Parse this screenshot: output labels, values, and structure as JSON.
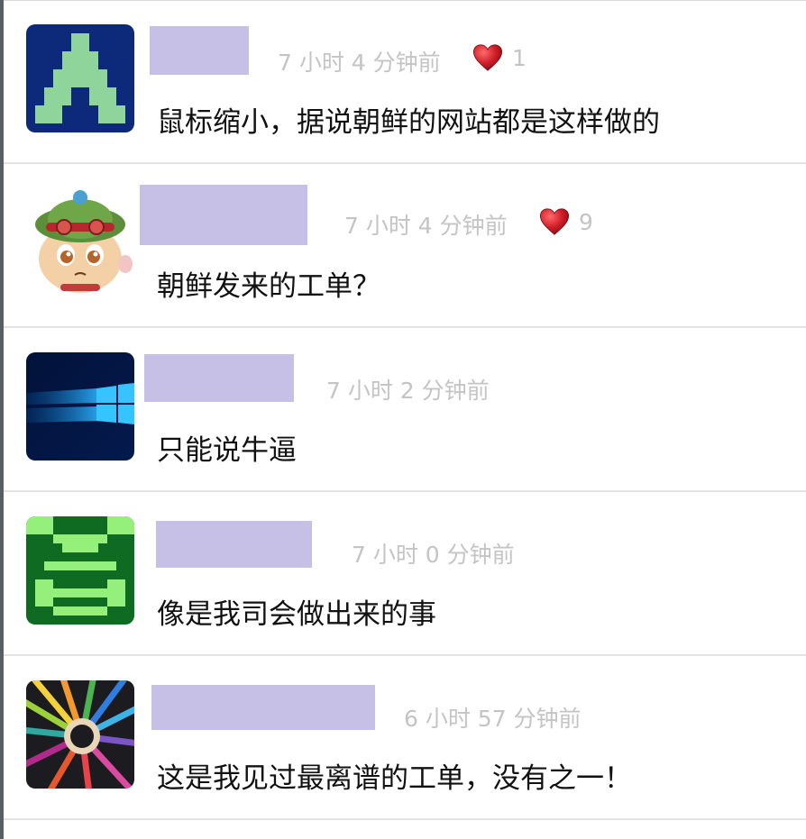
{
  "comments": [
    {
      "time": "7 小时 4 分钟前",
      "likes": "1",
      "text": "鼠标缩小，据说朝鲜的网站都是这样做的",
      "avatar_icon": "pixel-invader-avatar"
    },
    {
      "time": "7 小时 4 分钟前",
      "likes": "9",
      "text": "朝鲜发来的工单？",
      "avatar_icon": "cartoon-character-avatar"
    },
    {
      "time": "7 小时 2 分钟前",
      "text": "只能说牛逼",
      "avatar_icon": "windows-logo-avatar"
    },
    {
      "time": "7 小时 0 分钟前",
      "text": "像是我司会做出来的事",
      "avatar_icon": "pixel-face-avatar"
    },
    {
      "time": "6 小时 57 分钟前",
      "text": "这是我见过最离谱的工单，没有之一！",
      "avatar_icon": "colored-pencils-avatar"
    }
  ],
  "colors": {
    "username_placeholder": "#c7c0e6",
    "time_text": "#c4c4c4",
    "heart": "#d21f2a",
    "divider": "#e3e3e3"
  }
}
